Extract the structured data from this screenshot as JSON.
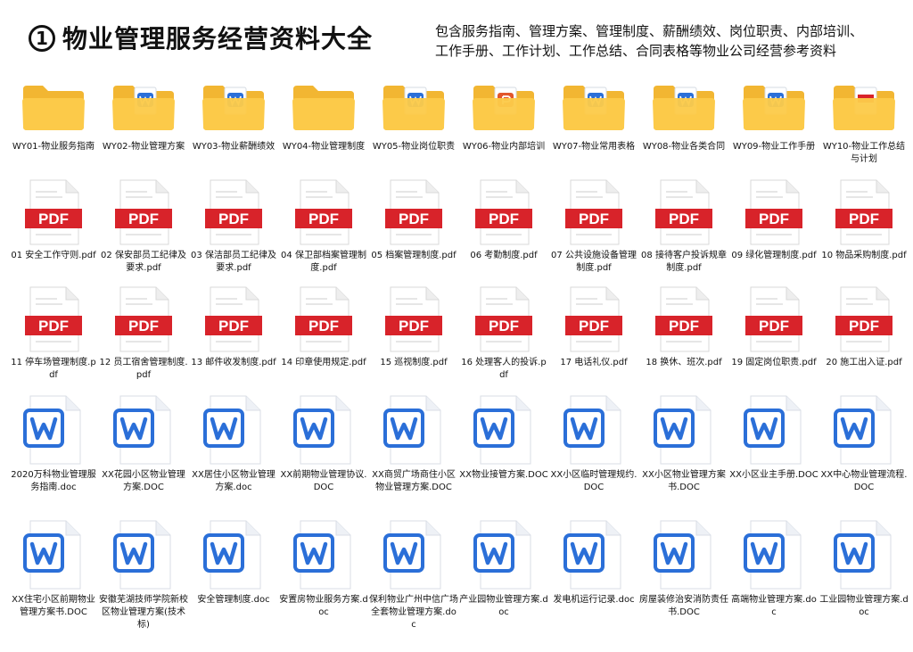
{
  "header": {
    "number": "1",
    "title": "物业管理服务经营资料大全",
    "subtitle_line1": "包含服务指南、管理方案、管理制度、薪酬绩效、岗位职责、内部培训、",
    "subtitle_line2": "工作手册、工作计划、工作总结、合同表格等物业公司经营参考资料"
  },
  "pdf_badge_text": "PDF",
  "rows": [
    {
      "type": "folder",
      "items": [
        {
          "label": "WY01-物业服务指南",
          "badge": "none"
        },
        {
          "label": "WY02-物业管理方案",
          "badge": "word"
        },
        {
          "label": "WY03-物业薪酬绩效",
          "badge": "word"
        },
        {
          "label": "WY04-物业管理制度",
          "badge": "none"
        },
        {
          "label": "WY05-物业岗位职责",
          "badge": "word"
        },
        {
          "label": "WY06-物业内部培训",
          "badge": "ppt"
        },
        {
          "label": "WY07-物业常用表格",
          "badge": "word"
        },
        {
          "label": "WY08-物业各类合同",
          "badge": "word"
        },
        {
          "label": "WY09-物业工作手册",
          "badge": "word"
        },
        {
          "label": "WY10-物业工作总结与计划",
          "badge": "pdf"
        }
      ]
    },
    {
      "type": "pdf",
      "items": [
        {
          "label": "01 安全工作守则.pdf"
        },
        {
          "label": "02 保安部员工纪律及要求.pdf"
        },
        {
          "label": "03 保洁部员工纪律及要求.pdf"
        },
        {
          "label": "04 保卫部档案管理制度.pdf"
        },
        {
          "label": "05 档案管理制度.pdf"
        },
        {
          "label": "06 考勤制度.pdf"
        },
        {
          "label": "07 公共设施设备管理制度.pdf"
        },
        {
          "label": "08 接待客户投诉规章制度.pdf"
        },
        {
          "label": "09 绿化管理制度.pdf"
        },
        {
          "label": "10 物品采购制度.pdf"
        }
      ]
    },
    {
      "type": "pdf",
      "items": [
        {
          "label": "11 停车场管理制度.pdf"
        },
        {
          "label": "12 员工宿舍管理制度.pdf"
        },
        {
          "label": "13 邮件收发制度.pdf"
        },
        {
          "label": "14 印章使用规定.pdf"
        },
        {
          "label": "15 巡视制度.pdf"
        },
        {
          "label": "16 处理客人的投诉.pdf"
        },
        {
          "label": "17 电话礼仪.pdf"
        },
        {
          "label": "18 换休、班次.pdf"
        },
        {
          "label": "19 固定岗位职责.pdf"
        },
        {
          "label": "20 施工出入证.pdf"
        }
      ]
    },
    {
      "type": "word",
      "items": [
        {
          "label": "2020万科物业管理服务指南.doc"
        },
        {
          "label": "XX花园小区物业管理方案.DOC"
        },
        {
          "label": "XX居住小区物业管理方案.doc"
        },
        {
          "label": "XX前期物业管理协议.DOC"
        },
        {
          "label": "XX商贸广场商住小区物业管理方案.DOC"
        },
        {
          "label": "XX物业接管方案.DOC"
        },
        {
          "label": "XX小区临时管理规约.DOC"
        },
        {
          "label": "XX小区物业管理方案书.DOC"
        },
        {
          "label": "XX小区业主手册.DOC"
        },
        {
          "label": "XX中心物业管理流程.DOC"
        }
      ]
    },
    {
      "type": "word",
      "items": [
        {
          "label": "XX住宅小区前期物业管理方案书.DOC"
        },
        {
          "label": "安徽芜湖技师学院新校区物业管理方案(技术标)"
        },
        {
          "label": "安全管理制度.doc"
        },
        {
          "label": "安置房物业服务方案.doc"
        },
        {
          "label": "保利物业广州中信广场全套物业管理方案.doc"
        },
        {
          "label": "产业园物业管理方案.doc"
        },
        {
          "label": "发电机运行记录.doc"
        },
        {
          "label": "房屋装修治安消防责任书.DOC"
        },
        {
          "label": "高端物业管理方案.doc"
        },
        {
          "label": "工业园物业管理方案.doc"
        }
      ]
    }
  ],
  "colors": {
    "folder_back": "#F2B632",
    "folder_front": "#FCCB4A",
    "pdf_red": "#D8232A",
    "word_blue": "#2B6FD8"
  }
}
